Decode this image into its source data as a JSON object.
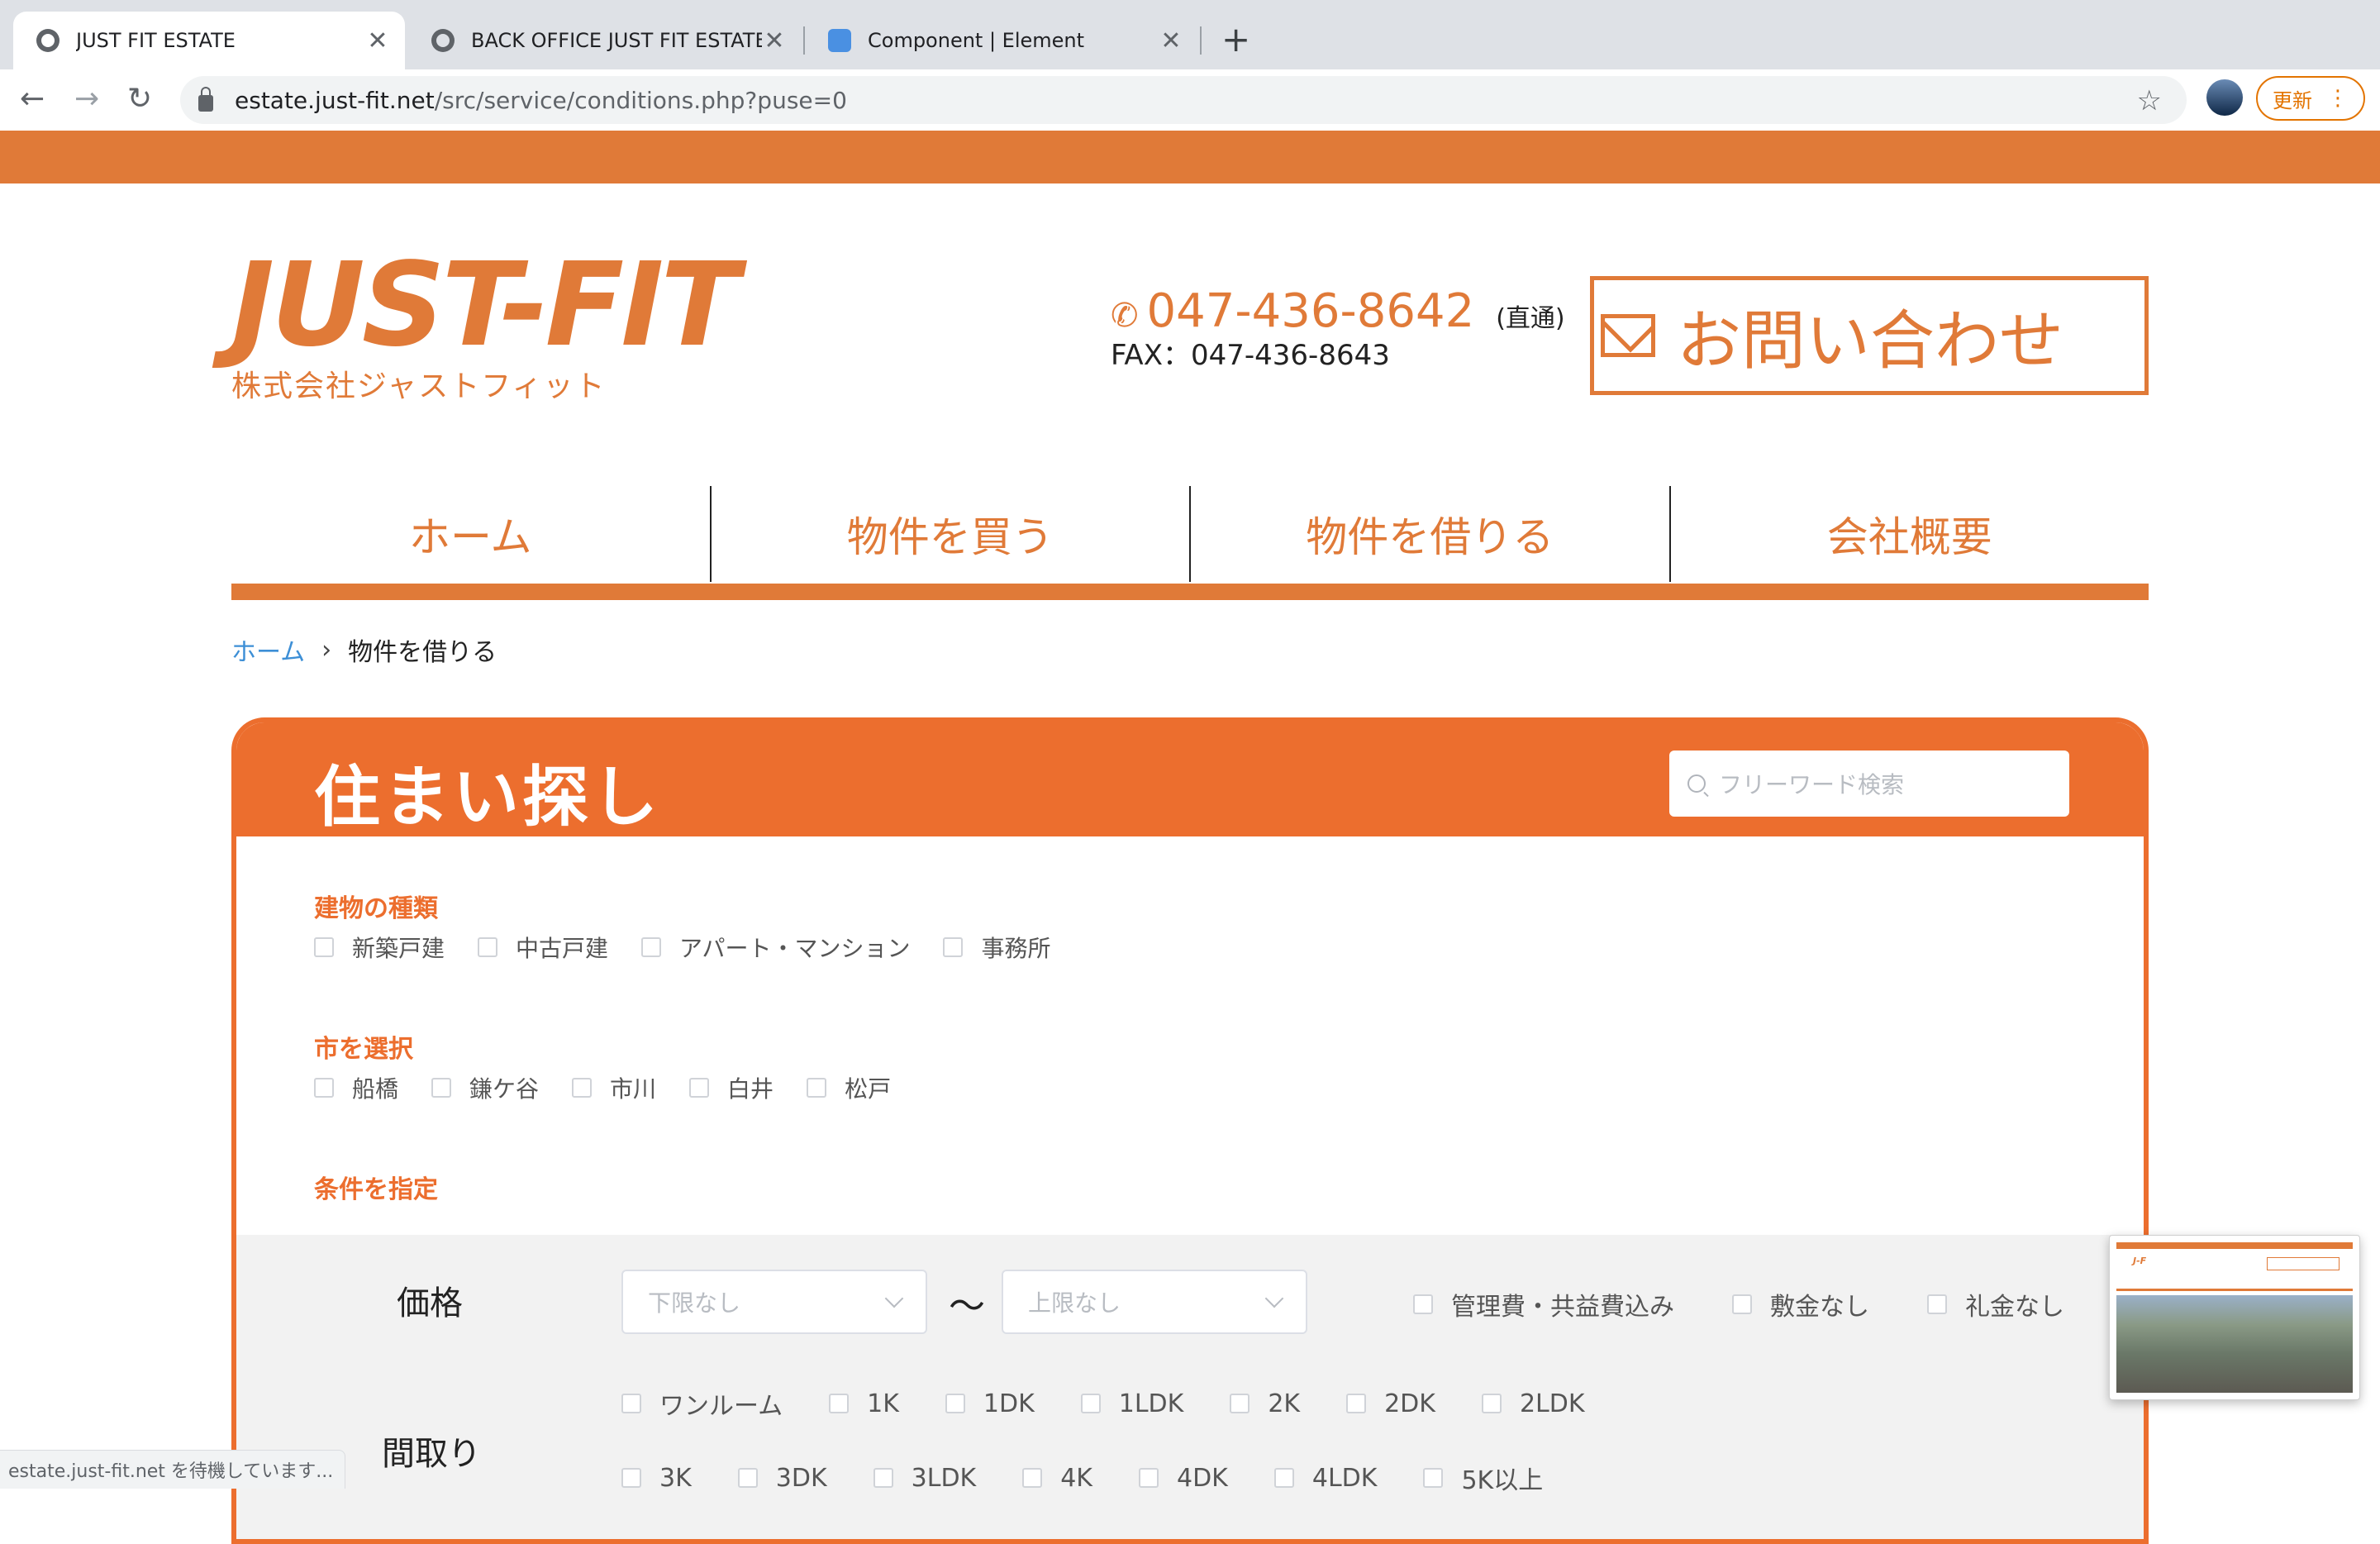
{
  "browser": {
    "tabs": [
      {
        "title": "JUST FIT ESTATE",
        "close": "✕"
      },
      {
        "title": "BACK OFFICE JUST FIT ESTATE",
        "close": "✕"
      },
      {
        "title": "Component | Element",
        "close": "✕"
      }
    ],
    "new_tab": "+",
    "back": "←",
    "forward": "→",
    "reload": "↻",
    "url_host": "estate.just-fit.net",
    "url_path": "/src/service/conditions.php?puse=0",
    "star": "☆",
    "update_label": "更新",
    "menu": "⋮",
    "status_text": "estate.just-fit.net を待機しています..."
  },
  "header": {
    "logo_mark": "JUST-FIT",
    "logo_sub": "株式会社ジャストフィット",
    "phone_icon": "✆",
    "tel": "047-436-8642",
    "tel_note": "(直通)",
    "fax": "FAX：047-436-8643",
    "contact_label": "お問い合わせ"
  },
  "nav": {
    "items": [
      "ホーム",
      "物件を買う",
      "物件を借りる",
      "会社概要"
    ]
  },
  "breadcrumb": {
    "home": "ホーム",
    "sep": "›",
    "current": "物件を借りる"
  },
  "search_panel": {
    "title": "住まい探し",
    "search_placeholder": "フリーワード検索",
    "building_type": {
      "title": "建物の種類",
      "options": [
        "新築戸建",
        "中古戸建",
        "アパート・マンション",
        "事務所"
      ]
    },
    "city": {
      "title": "市を選択",
      "options": [
        "船橋",
        "鎌ケ谷",
        "市川",
        "白井",
        "松戸"
      ]
    },
    "conditions": {
      "title": "条件を指定",
      "price_label": "価格",
      "price_min": "下限なし",
      "price_max": "上限なし",
      "range_sep": "〜",
      "price_options": [
        "管理費・共益費込み",
        "敷金なし",
        "礼金なし"
      ],
      "layout_label": "間取り",
      "layout_row1": [
        "ワンルーム",
        "1K",
        "1DK",
        "1LDK",
        "2K",
        "2DK",
        "2LDK"
      ],
      "layout_row2": [
        "3K",
        "3DK",
        "3LDK",
        "4K",
        "4DK",
        "4LDK",
        "5K以上"
      ]
    }
  },
  "colors": {
    "brand_orange": "#e07a38",
    "panel_orange": "#ec6e2e",
    "link_blue": "#3d8fd6"
  }
}
